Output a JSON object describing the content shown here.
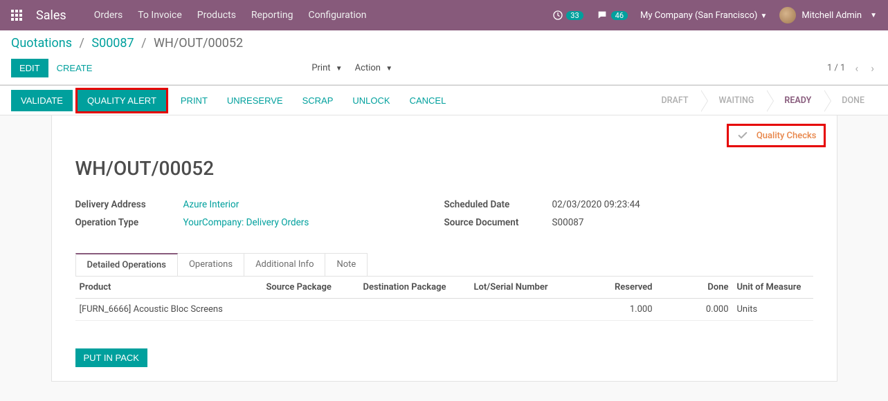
{
  "navbar": {
    "brand": "Sales",
    "menu": [
      "Orders",
      "To Invoice",
      "Products",
      "Reporting",
      "Configuration"
    ],
    "activities_count": "33",
    "messages_count": "46",
    "company": "My Company (San Francisco)",
    "user": "Mitchell Admin"
  },
  "breadcrumb": {
    "level1": "Quotations",
    "level2": "S00087",
    "level3": "WH/OUT/00052"
  },
  "controls": {
    "edit": "EDIT",
    "create": "CREATE",
    "print": "Print",
    "action": "Action",
    "pager": "1 / 1"
  },
  "statusbar": {
    "validate": "VALIDATE",
    "quality_alert": "QUALITY ALERT",
    "print": "PRINT",
    "unreserve": "UNRESERVE",
    "scrap": "SCRAP",
    "unlock": "UNLOCK",
    "cancel": "CANCEL",
    "stages": [
      "DRAFT",
      "WAITING",
      "READY",
      "DONE"
    ],
    "active_stage": "READY"
  },
  "quality_checks_label": "Quality Checks",
  "record": {
    "title": "WH/OUT/00052",
    "delivery_address_label": "Delivery Address",
    "delivery_address": "Azure Interior",
    "operation_type_label": "Operation Type",
    "operation_type": "YourCompany: Delivery Orders",
    "scheduled_date_label": "Scheduled Date",
    "scheduled_date": "02/03/2020 09:23:44",
    "source_document_label": "Source Document",
    "source_document": "S00087"
  },
  "tabs": [
    "Detailed Operations",
    "Operations",
    "Additional Info",
    "Note"
  ],
  "table": {
    "headers": {
      "product": "Product",
      "source_package": "Source Package",
      "destination_package": "Destination Package",
      "lot": "Lot/Serial Number",
      "reserved": "Reserved",
      "done": "Done",
      "uom": "Unit of Measure"
    },
    "rows": [
      {
        "product": "[FURN_6666] Acoustic Bloc Screens",
        "source_package": "",
        "destination_package": "",
        "lot": "",
        "reserved": "1.000",
        "done": "0.000",
        "uom": "Units"
      }
    ]
  },
  "put_in_pack": "PUT IN PACK"
}
